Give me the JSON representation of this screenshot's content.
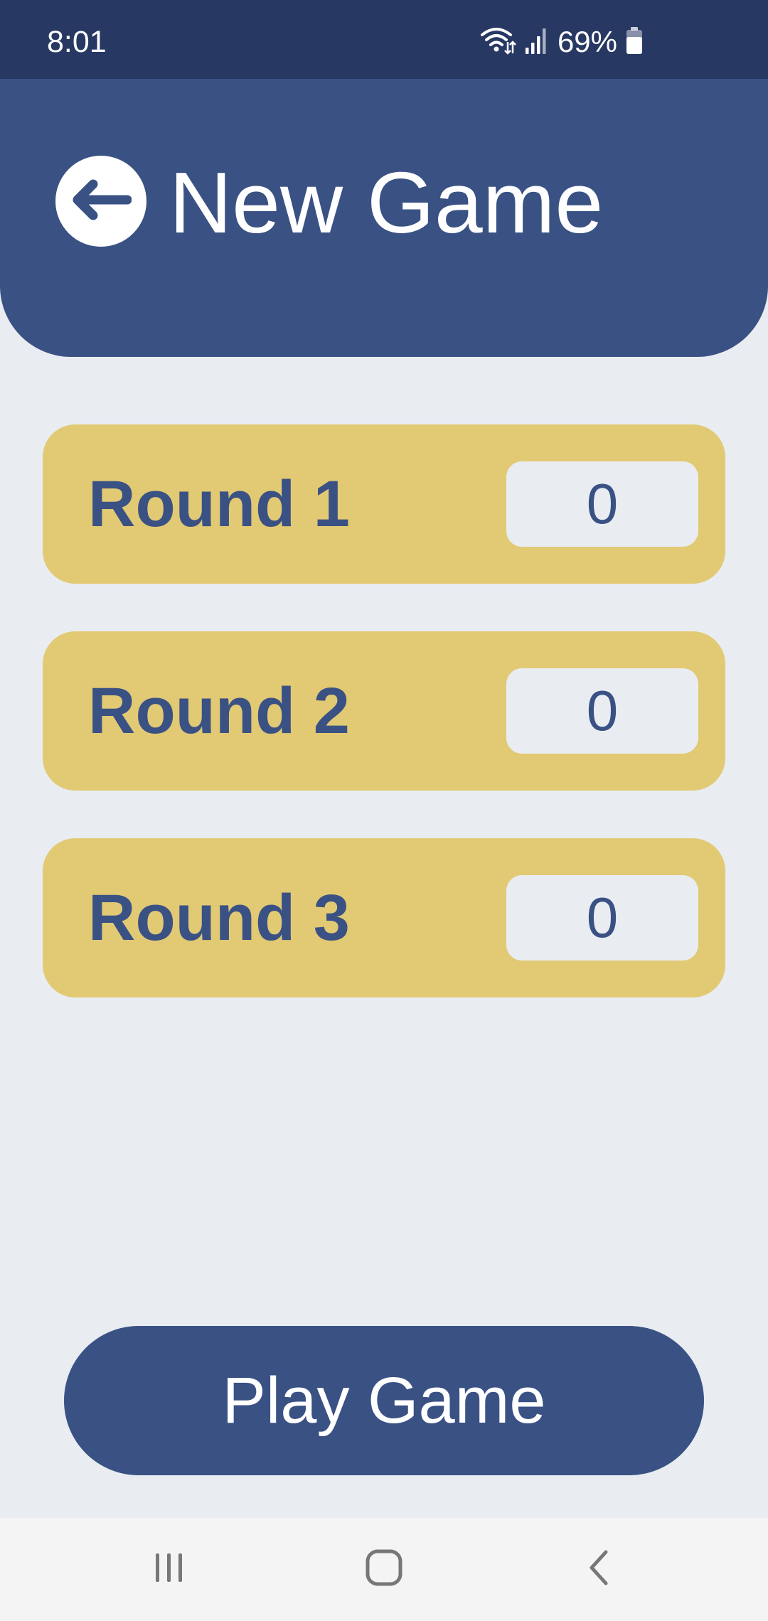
{
  "status_bar": {
    "time": "8:01",
    "battery_percent": "69%",
    "icons": [
      "wifi-icon",
      "signal-icon",
      "battery-icon"
    ]
  },
  "header": {
    "title": "New Game",
    "back_icon": "arrow-left-icon"
  },
  "rounds": [
    {
      "label": "Round 1",
      "value": "0"
    },
    {
      "label": "Round 2",
      "value": "0"
    },
    {
      "label": "Round 3",
      "value": "0"
    }
  ],
  "play_button": {
    "label": "Play Game"
  },
  "nav_bar": {
    "icons": [
      "recent-apps-icon",
      "home-icon",
      "back-icon"
    ]
  },
  "colors": {
    "status_bar": "#273863",
    "primary": "#3a5184",
    "card": "#e2c974",
    "background": "#e9edf2"
  }
}
